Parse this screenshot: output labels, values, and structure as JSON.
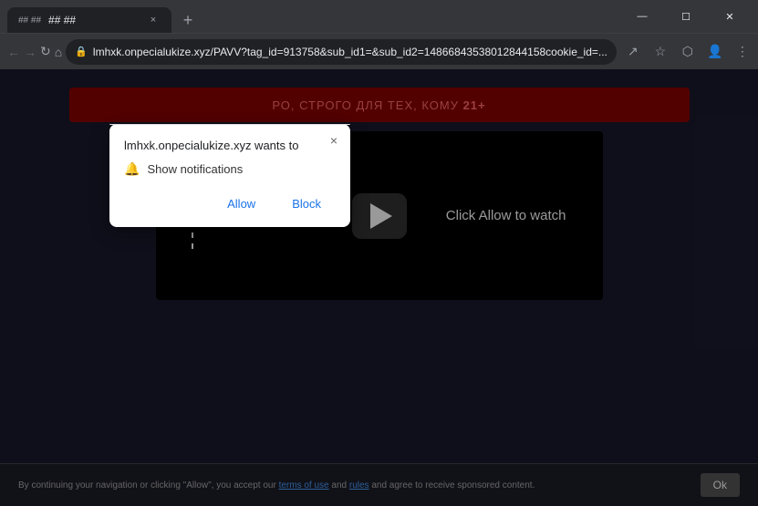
{
  "browser": {
    "tab": {
      "favicon": "## ##",
      "title": "## ##",
      "close_label": "×"
    },
    "new_tab_label": "+",
    "window_controls": {
      "minimize": "—",
      "maximize": "☐",
      "close": "✕"
    },
    "toolbar": {
      "back_label": "←",
      "forward_label": "→",
      "refresh_label": "↻",
      "home_label": "⌂",
      "url": "lmhxk.onpecialukize.xyz/PAVV?tag_id=913758&sub_id1=&sub_id2=14866843538012844158cookie_id=...",
      "share_label": "↗",
      "bookmark_label": "☆",
      "extensions_label": "⬡",
      "profile_label": "👤",
      "menu_label": "⋮"
    }
  },
  "notification_dialog": {
    "site": "lmhxk.onpecialukize.xyz wants to",
    "option_label": "Show notifications",
    "allow_label": "Allow",
    "block_label": "Block",
    "close_label": "×",
    "bell_icon": "🔔"
  },
  "website": {
    "header_text": "РО, СТРОГО ДЛЯ ТЕХ, КОМУ ",
    "header_age": "21+",
    "video": {
      "click_allow_text": "Click Allow to watch"
    }
  },
  "cookie_bar": {
    "text": "By continuing your navigation or clicking \"Allow\", you accept our ",
    "link1": "terms of use",
    "text2": " and ",
    "link2": "rules",
    "text3": " and agree to receive sponsored content.",
    "ok_label": "Ok"
  }
}
